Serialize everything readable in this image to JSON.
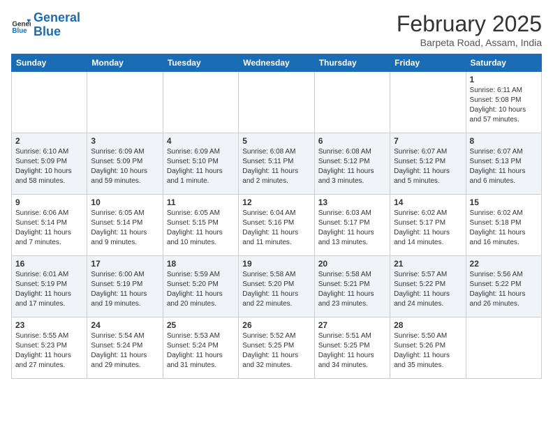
{
  "header": {
    "logo_line1": "General",
    "logo_line2": "Blue",
    "month_title": "February 2025",
    "location": "Barpeta Road, Assam, India"
  },
  "days_of_week": [
    "Sunday",
    "Monday",
    "Tuesday",
    "Wednesday",
    "Thursday",
    "Friday",
    "Saturday"
  ],
  "weeks": [
    [
      {
        "day": "",
        "info": ""
      },
      {
        "day": "",
        "info": ""
      },
      {
        "day": "",
        "info": ""
      },
      {
        "day": "",
        "info": ""
      },
      {
        "day": "",
        "info": ""
      },
      {
        "day": "",
        "info": ""
      },
      {
        "day": "1",
        "info": "Sunrise: 6:11 AM\nSunset: 5:08 PM\nDaylight: 10 hours\nand 57 minutes."
      }
    ],
    [
      {
        "day": "2",
        "info": "Sunrise: 6:10 AM\nSunset: 5:09 PM\nDaylight: 10 hours\nand 58 minutes."
      },
      {
        "day": "3",
        "info": "Sunrise: 6:09 AM\nSunset: 5:09 PM\nDaylight: 10 hours\nand 59 minutes."
      },
      {
        "day": "4",
        "info": "Sunrise: 6:09 AM\nSunset: 5:10 PM\nDaylight: 11 hours\nand 1 minute."
      },
      {
        "day": "5",
        "info": "Sunrise: 6:08 AM\nSunset: 5:11 PM\nDaylight: 11 hours\nand 2 minutes."
      },
      {
        "day": "6",
        "info": "Sunrise: 6:08 AM\nSunset: 5:12 PM\nDaylight: 11 hours\nand 3 minutes."
      },
      {
        "day": "7",
        "info": "Sunrise: 6:07 AM\nSunset: 5:12 PM\nDaylight: 11 hours\nand 5 minutes."
      },
      {
        "day": "8",
        "info": "Sunrise: 6:07 AM\nSunset: 5:13 PM\nDaylight: 11 hours\nand 6 minutes."
      }
    ],
    [
      {
        "day": "9",
        "info": "Sunrise: 6:06 AM\nSunset: 5:14 PM\nDaylight: 11 hours\nand 7 minutes."
      },
      {
        "day": "10",
        "info": "Sunrise: 6:05 AM\nSunset: 5:14 PM\nDaylight: 11 hours\nand 9 minutes."
      },
      {
        "day": "11",
        "info": "Sunrise: 6:05 AM\nSunset: 5:15 PM\nDaylight: 11 hours\nand 10 minutes."
      },
      {
        "day": "12",
        "info": "Sunrise: 6:04 AM\nSunset: 5:16 PM\nDaylight: 11 hours\nand 11 minutes."
      },
      {
        "day": "13",
        "info": "Sunrise: 6:03 AM\nSunset: 5:17 PM\nDaylight: 11 hours\nand 13 minutes."
      },
      {
        "day": "14",
        "info": "Sunrise: 6:02 AM\nSunset: 5:17 PM\nDaylight: 11 hours\nand 14 minutes."
      },
      {
        "day": "15",
        "info": "Sunrise: 6:02 AM\nSunset: 5:18 PM\nDaylight: 11 hours\nand 16 minutes."
      }
    ],
    [
      {
        "day": "16",
        "info": "Sunrise: 6:01 AM\nSunset: 5:19 PM\nDaylight: 11 hours\nand 17 minutes."
      },
      {
        "day": "17",
        "info": "Sunrise: 6:00 AM\nSunset: 5:19 PM\nDaylight: 11 hours\nand 19 minutes."
      },
      {
        "day": "18",
        "info": "Sunrise: 5:59 AM\nSunset: 5:20 PM\nDaylight: 11 hours\nand 20 minutes."
      },
      {
        "day": "19",
        "info": "Sunrise: 5:58 AM\nSunset: 5:20 PM\nDaylight: 11 hours\nand 22 minutes."
      },
      {
        "day": "20",
        "info": "Sunrise: 5:58 AM\nSunset: 5:21 PM\nDaylight: 11 hours\nand 23 minutes."
      },
      {
        "day": "21",
        "info": "Sunrise: 5:57 AM\nSunset: 5:22 PM\nDaylight: 11 hours\nand 24 minutes."
      },
      {
        "day": "22",
        "info": "Sunrise: 5:56 AM\nSunset: 5:22 PM\nDaylight: 11 hours\nand 26 minutes."
      }
    ],
    [
      {
        "day": "23",
        "info": "Sunrise: 5:55 AM\nSunset: 5:23 PM\nDaylight: 11 hours\nand 27 minutes."
      },
      {
        "day": "24",
        "info": "Sunrise: 5:54 AM\nSunset: 5:24 PM\nDaylight: 11 hours\nand 29 minutes."
      },
      {
        "day": "25",
        "info": "Sunrise: 5:53 AM\nSunset: 5:24 PM\nDaylight: 11 hours\nand 31 minutes."
      },
      {
        "day": "26",
        "info": "Sunrise: 5:52 AM\nSunset: 5:25 PM\nDaylight: 11 hours\nand 32 minutes."
      },
      {
        "day": "27",
        "info": "Sunrise: 5:51 AM\nSunset: 5:25 PM\nDaylight: 11 hours\nand 34 minutes."
      },
      {
        "day": "28",
        "info": "Sunrise: 5:50 AM\nSunset: 5:26 PM\nDaylight: 11 hours\nand 35 minutes."
      },
      {
        "day": "",
        "info": ""
      }
    ]
  ]
}
